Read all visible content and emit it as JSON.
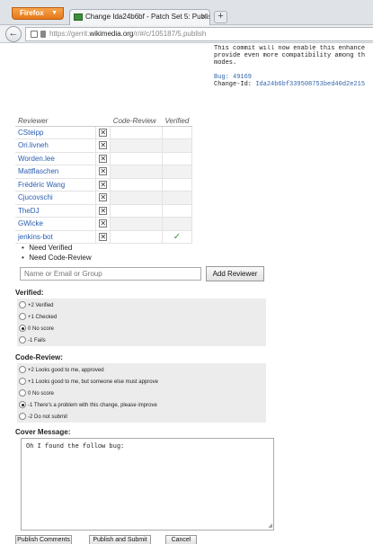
{
  "browser": {
    "menu_label": "Firefox",
    "tab_title": "Change Ida24b6bf - Patch Set 5: Publish ...",
    "new_tab": "+",
    "url_prefix": "https://gerrit.",
    "url_domain": "wikimedia.org",
    "url_suffix": "/r/#/c/105187/5,publish"
  },
  "commit_message": {
    "line1": "This commit will now enable this enhance",
    "line2": "provide even more compatibility among th",
    "line3": "modes.",
    "bug": "Bug: 49169",
    "change_id_label": "Change-Id: ",
    "change_id": "Ida24b6bf339508753bed40d2e215"
  },
  "reviewers": {
    "headers": {
      "reviewer": "Reviewer",
      "code_review": "Code-Review",
      "verified": "Verified"
    },
    "rows": [
      {
        "name": "CSteipp",
        "verified": ""
      },
      {
        "name": "Ori.livneh",
        "verified": ""
      },
      {
        "name": "Worden.lee",
        "verified": ""
      },
      {
        "name": "Mattflaschen",
        "verified": ""
      },
      {
        "name": "Frédéric Wang",
        "verified": ""
      },
      {
        "name": "Cjucovschi",
        "verified": ""
      },
      {
        "name": "TheDJ",
        "verified": ""
      },
      {
        "name": "GWicke",
        "verified": ""
      },
      {
        "name": "jenkins-bot",
        "verified": "✓"
      }
    ],
    "remove_glyph": "✕"
  },
  "needs": [
    "Need Verified",
    "Need Code-Review"
  ],
  "add_reviewer": {
    "placeholder": "Name or Email or Group",
    "button": "Add Reviewer"
  },
  "verified": {
    "label": "Verified:",
    "options": [
      {
        "text": "+2 Verified",
        "checked": false
      },
      {
        "text": "+1 Checked",
        "checked": false
      },
      {
        "text": "0 No score",
        "checked": true
      },
      {
        "text": "-1 Fails",
        "checked": false
      }
    ]
  },
  "code_review": {
    "label": "Code-Review:",
    "options": [
      {
        "text": "+2 Looks good to me, approved",
        "checked": false
      },
      {
        "text": "+1 Looks good to me, but someone else must approve",
        "checked": false
      },
      {
        "text": "0 No score",
        "checked": false
      },
      {
        "text": "-1 There's a problem with this change, please improve",
        "checked": true
      },
      {
        "text": "-2 Do not submit",
        "checked": false
      }
    ]
  },
  "cover": {
    "label": "Cover Message:",
    "text": "Oh I found the follow bug:"
  },
  "buttons": {
    "publish_comments": "Publish Comments",
    "publish_submit": "Publish and Submit",
    "cancel": "Cancel"
  }
}
